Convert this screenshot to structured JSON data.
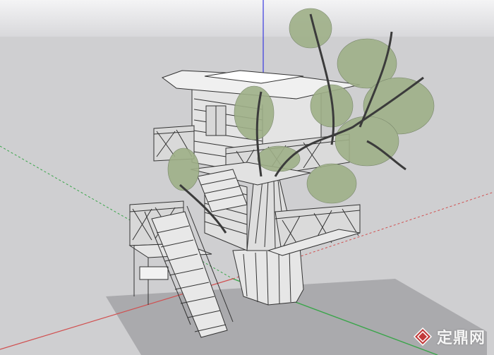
{
  "viewport": {
    "colors": {
      "sky_top": "#f4f4f5",
      "sky_bottom": "#d8d8db",
      "ground": "#cfcfd1",
      "axis_red": "#d05050",
      "axis_green": "#3aa54a",
      "axis_blue": "#3a3adf",
      "foliage": "#9fb088",
      "line": "#333333"
    }
  },
  "model": {
    "icon": "treehouse-model"
  },
  "watermark": {
    "text": "定鼎网",
    "icon": "diamond-logo-icon"
  }
}
